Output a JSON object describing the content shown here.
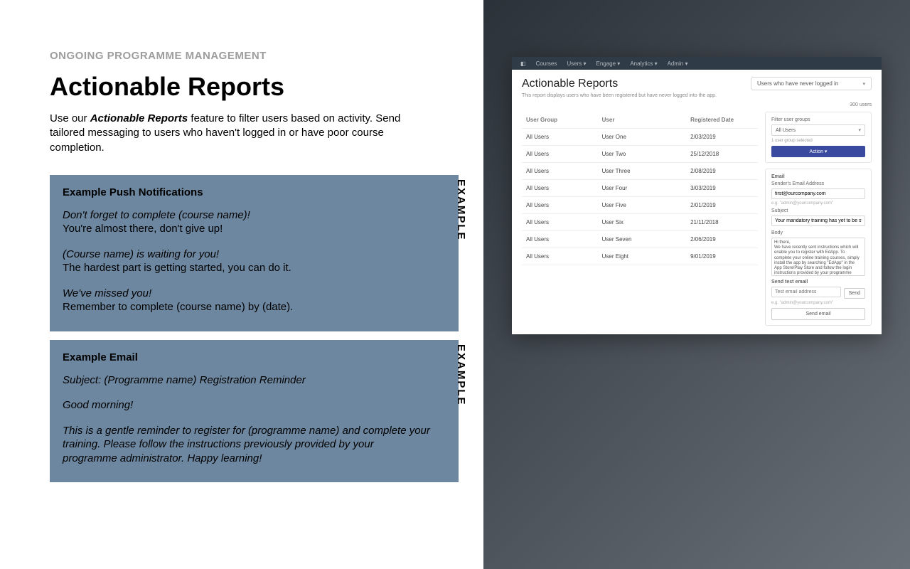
{
  "eyebrow": "ONGOING PROGRAMME MANAGEMENT",
  "title": "Actionable Reports",
  "intro_pre": "Use our ",
  "intro_bold": "Actionable Reports",
  "intro_post": " feature to filter users based on activity. Send tailored messaging to users who haven't logged in or have poor course completion.",
  "example_label": "EXAMPLE",
  "push": {
    "heading": "Example Push Notifications",
    "g1_line1": "Don't forget to complete (course name)!",
    "g1_line2": "You're almost there, don't give up!",
    "g2_line1": "(Course name) is waiting for you!",
    "g2_line2": "The hardest part is getting started, you can do it.",
    "g3_line1": "We've missed you!",
    "g3_line2": "Remember to complete (course name) by (date)."
  },
  "email": {
    "heading": "Example Email",
    "subject": "Subject: (Programme name) Registration Reminder",
    "greeting": "Good morning!",
    "body": "This is a gentle reminder to register for (programme name) and complete your training. Please follow the instructions previously provided by your programme administrator. Happy learning!"
  },
  "app": {
    "nav": {
      "courses": "Courses",
      "users": "Users ▾",
      "engage": "Engage ▾",
      "analytics": "Analytics ▾",
      "admin": "Admin ▾"
    },
    "title": "Actionable Reports",
    "dropdown": "Users who have never logged in",
    "desc": "This report displays users who have been registered but have never logged into the app.",
    "count": "300 users",
    "columns": {
      "c1": "User Group",
      "c2": "User",
      "c3": "Registered Date"
    },
    "rows": [
      {
        "g": "All Users",
        "u": "User One",
        "d": "2/03/2019"
      },
      {
        "g": "All Users",
        "u": "User Two",
        "d": "25/12/2018"
      },
      {
        "g": "All Users",
        "u": "User Three",
        "d": "2/08/2019"
      },
      {
        "g": "All Users",
        "u": "User Four",
        "d": "3/03/2019"
      },
      {
        "g": "All Users",
        "u": "User Five",
        "d": "2/01/2019"
      },
      {
        "g": "All Users",
        "u": "User Six",
        "d": "21/11/2018"
      },
      {
        "g": "All Users",
        "u": "User Seven",
        "d": "2/06/2019"
      },
      {
        "g": "All Users",
        "u": "User Eight",
        "d": "9/01/2019"
      }
    ],
    "side": {
      "filter_label": "Filter user groups",
      "filter_value": "All Users",
      "filter_note": "1 user group selected",
      "action": "Action ▾",
      "email_heading": "Email",
      "sender_label": "Sender's Email Address",
      "sender_value": "first@ourcompany.com",
      "sender_hint": "e.g. \"admin@yourcompany.com\"",
      "subject_label": "Subject",
      "subject_value": "Your mandatory training has yet to be started",
      "body_label": "Body",
      "body_value": "Hi there,\nWe have recently sent instructions which will enable you to register with EdApp. To complete your online training courses, simply install the app by searching \"EdApp\" in the App Store/Play Store and follow the login instructions provided by your programme administrator.",
      "testemail_label": "Send test email",
      "testemail_placeholder": "Test email address",
      "testemail_hint": "e.g. \"admin@yourcompany.com\"",
      "send": "Send",
      "sendemail": "Send email"
    }
  }
}
